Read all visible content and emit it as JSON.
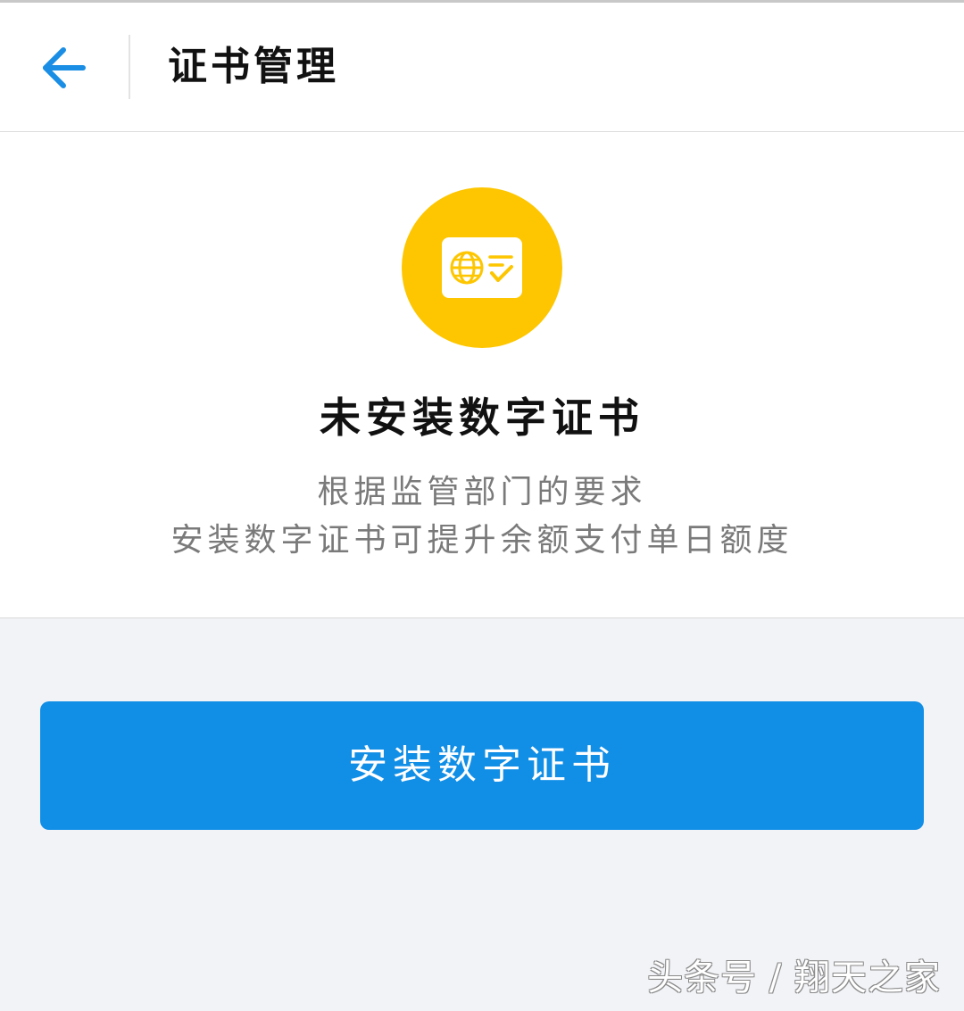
{
  "header": {
    "title": "证书管理",
    "back_icon": "arrow-left-icon",
    "accent": "#1a8ee4"
  },
  "status": {
    "icon": "certificate-globe-check-icon",
    "icon_bg": "#fdc600",
    "title": "未安装数字证书",
    "desc_line_1": "根据监管部门的要求",
    "desc_line_2": "安装数字证书可提升余额支付单日额度"
  },
  "actions": {
    "install_label": "安装数字证书",
    "button_color": "#118ee6"
  },
  "watermark": {
    "text": "头条号 / 翔天之家"
  }
}
